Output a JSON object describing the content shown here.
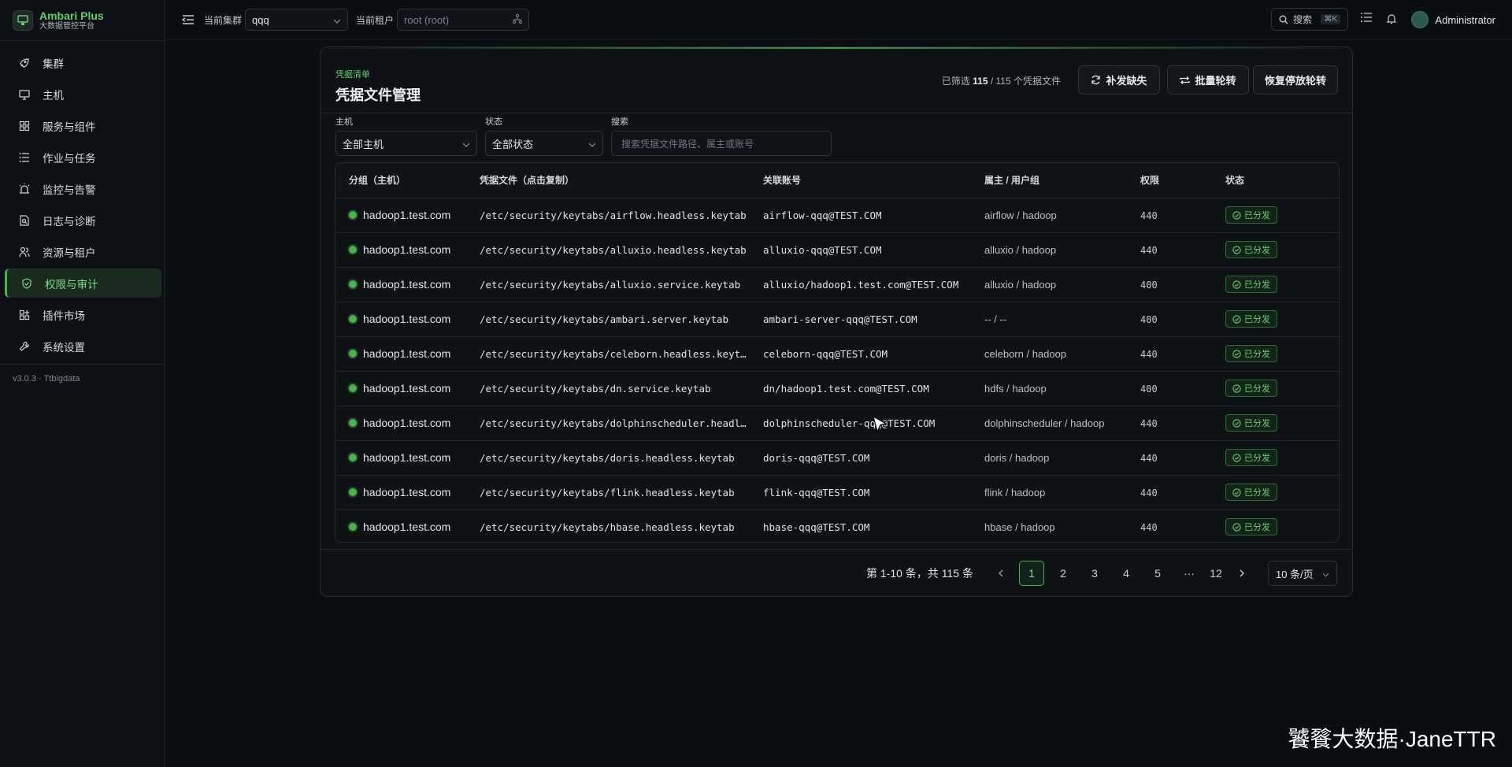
{
  "brand": {
    "name": "Ambari Plus",
    "sub": "大数据管控平台"
  },
  "nav": [
    {
      "label": "集群",
      "icon": "rocket-icon"
    },
    {
      "label": "主机",
      "icon": "monitor-icon"
    },
    {
      "label": "服务与组件",
      "icon": "grid-icon"
    },
    {
      "label": "作业与任务",
      "icon": "list-icon"
    },
    {
      "label": "监控与告警",
      "icon": "alarm-icon"
    },
    {
      "label": "日志与诊断",
      "icon": "file-search-icon"
    },
    {
      "label": "资源与租户",
      "icon": "users-icon"
    },
    {
      "label": "权限与审计",
      "icon": "shield-check-icon",
      "active": true
    },
    {
      "label": "插件市场",
      "icon": "plugin-icon"
    },
    {
      "label": "系统设置",
      "icon": "wrench-icon"
    }
  ],
  "version": "v3.0.3 · Ttbigdata",
  "topbar": {
    "cluster_label": "当前集群",
    "cluster_value": "qqq",
    "tenant_label": "当前租户",
    "tenant_placeholder": "root (root)",
    "search_label": "搜索",
    "search_kbd": "⌘K",
    "user": "Administrator"
  },
  "card": {
    "eyebrow": "凭据清单",
    "title": "凭据文件管理",
    "filter_prefix": "已筛选",
    "filter_count": "115",
    "filter_suffix": "/ 115 个凭据文件",
    "btn_fill": "补发缺失",
    "btn_rotate": "批量轮转",
    "btn_resume": "恢复停放轮转"
  },
  "filters": {
    "host_label": "主机",
    "host_value": "全部主机",
    "status_label": "状态",
    "status_value": "全部状态",
    "search_label": "搜索",
    "search_placeholder": "搜索凭据文件路径、属主或账号"
  },
  "table": {
    "headers": [
      "分组（主机）",
      "凭据文件（点击复制）",
      "关联账号",
      "属主 / 用户组",
      "权限",
      "状态"
    ],
    "rows": [
      {
        "host": "hadoop1.test.com",
        "file": "/etc/security/keytabs/airflow.headless.keytab",
        "principal": "airflow-qqq@TEST.COM",
        "owner": "airflow / hadoop",
        "perm": "440",
        "status": "已分发"
      },
      {
        "host": "hadoop1.test.com",
        "file": "/etc/security/keytabs/alluxio.headless.keytab",
        "principal": "alluxio-qqq@TEST.COM",
        "owner": "alluxio / hadoop",
        "perm": "440",
        "status": "已分发"
      },
      {
        "host": "hadoop1.test.com",
        "file": "/etc/security/keytabs/alluxio.service.keytab",
        "principal": "alluxio/hadoop1.test.com@TEST.COM",
        "owner": "alluxio / hadoop",
        "perm": "400",
        "status": "已分发"
      },
      {
        "host": "hadoop1.test.com",
        "file": "/etc/security/keytabs/ambari.server.keytab",
        "principal": "ambari-server-qqq@TEST.COM",
        "owner": "-- / --",
        "perm": "400",
        "status": "已分发"
      },
      {
        "host": "hadoop1.test.com",
        "file": "/etc/security/keytabs/celeborn.headless.keytab",
        "principal": "celeborn-qqq@TEST.COM",
        "owner": "celeborn / hadoop",
        "perm": "440",
        "status": "已分发"
      },
      {
        "host": "hadoop1.test.com",
        "file": "/etc/security/keytabs/dn.service.keytab",
        "principal": "dn/hadoop1.test.com@TEST.COM",
        "owner": "hdfs / hadoop",
        "perm": "400",
        "status": "已分发"
      },
      {
        "host": "hadoop1.test.com",
        "file": "/etc/security/keytabs/dolphinscheduler.headless.keytab",
        "principal": "dolphinscheduler-qqq@TEST.COM",
        "owner": "dolphinscheduler / hadoop",
        "perm": "440",
        "status": "已分发"
      },
      {
        "host": "hadoop1.test.com",
        "file": "/etc/security/keytabs/doris.headless.keytab",
        "principal": "doris-qqq@TEST.COM",
        "owner": "doris / hadoop",
        "perm": "440",
        "status": "已分发"
      },
      {
        "host": "hadoop1.test.com",
        "file": "/etc/security/keytabs/flink.headless.keytab",
        "principal": "flink-qqq@TEST.COM",
        "owner": "flink / hadoop",
        "perm": "440",
        "status": "已分发"
      },
      {
        "host": "hadoop1.test.com",
        "file": "/etc/security/keytabs/hbase.headless.keytab",
        "principal": "hbase-qqq@TEST.COM",
        "owner": "hbase / hadoop",
        "perm": "440",
        "status": "已分发"
      }
    ]
  },
  "pagination": {
    "total_text": "第 1-10 条，共 115 条",
    "pages": [
      "1",
      "2",
      "3",
      "4",
      "5",
      "···",
      "12"
    ],
    "current": "1",
    "page_size": "10 条/页"
  },
  "watermark": "饕餮大数据·JaneTTR",
  "colors": {
    "accent": "#4caf50",
    "background": "#0b0e11"
  }
}
